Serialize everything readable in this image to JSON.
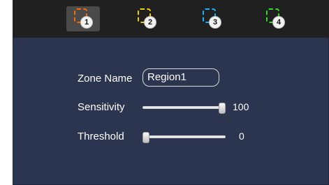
{
  "tabs": [
    {
      "number": "1",
      "color": "#ff6a00",
      "selected": true
    },
    {
      "number": "2",
      "color": "#f0d000",
      "selected": false
    },
    {
      "number": "3",
      "color": "#18b4ff",
      "selected": false
    },
    {
      "number": "4",
      "color": "#33dd22",
      "selected": false
    }
  ],
  "zone_name": {
    "label": "Zone Name",
    "value": "Region1"
  },
  "sensitivity": {
    "label": "Sensitivity",
    "value": "100",
    "fraction": 1.0
  },
  "threshold": {
    "label": "Threshold",
    "value": "0",
    "fraction": 0.0
  }
}
